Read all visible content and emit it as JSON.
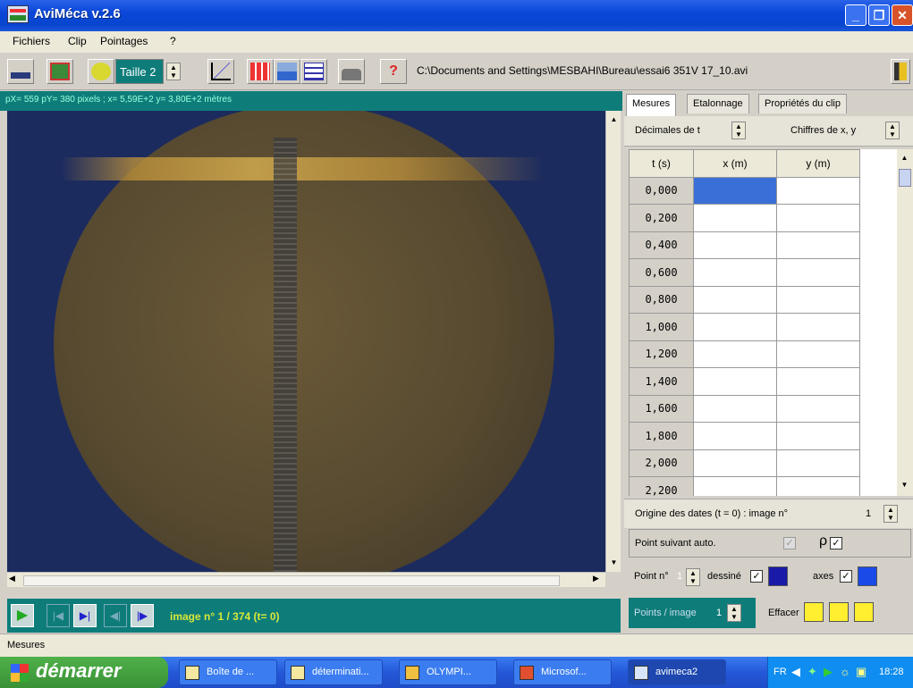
{
  "window": {
    "title": "AviMéca v.2.6"
  },
  "menu": {
    "items": [
      "Fichiers",
      "Clip",
      "Pointages",
      "?"
    ]
  },
  "toolbar": {
    "taille_label": "Taille 2",
    "path": "C:\\Documents and Settings\\MESBAHI\\Bureau\\essai6 351V 17_10.avi"
  },
  "infobar": {
    "text": "pX= 559   pY= 380 pixels   ;   x= 5,59E+2   y= 3,80E+2 mètres"
  },
  "player": {
    "image_label": "image n° 1 / 374   (t= 0)"
  },
  "tabs": [
    "Mesures",
    "Etalonnage",
    "Propriétés du clip"
  ],
  "decimals": {
    "t_label": "Décimales de t",
    "xy_label": "Chiffres de x, y"
  },
  "table": {
    "headers": [
      "t (s)",
      "x (m)",
      "y (m)"
    ],
    "t_values": [
      "0,000",
      "0,200",
      "0,400",
      "0,600",
      "0,800",
      "1,000",
      "1,200",
      "1,400",
      "1,600",
      "1,800",
      "2,000",
      "2,200"
    ]
  },
  "origin": {
    "label": "Origine des dates (t = 0) : image n°",
    "value": "1"
  },
  "point_auto": {
    "label": "Point suivant auto."
  },
  "point_row": {
    "point_label": "Point n°",
    "point_value": "1",
    "dessine_label": "dessiné",
    "axes_label": "axes"
  },
  "points_image": {
    "label": "Points / image",
    "value": "1",
    "effacer_label": "Effacer"
  },
  "statusbar": {
    "text": "Mesures"
  },
  "taskbar": {
    "start_label": "démarrer",
    "tasks": [
      "Boîte de ...",
      "déterminati...",
      "OLYMPI...",
      "Microsof...",
      "avimeca2"
    ],
    "lang": "FR",
    "clock": "18:28"
  },
  "colors": {
    "accent": "#0e7d7a",
    "title": "#0a46d8",
    "selection": "#3a6fd8"
  }
}
